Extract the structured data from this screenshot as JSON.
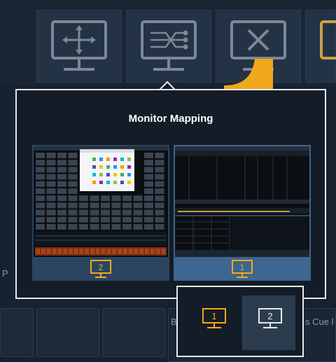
{
  "popup": {
    "title": "Monitor Mapping"
  },
  "monitors": [
    {
      "number": "2",
      "color": "#f0a81c"
    },
    {
      "number": "1",
      "color": "#f0a81c"
    }
  ],
  "selector": [
    {
      "number": "1",
      "color": "#f0a81c"
    },
    {
      "number": "2",
      "color": "#e6e9ee"
    }
  ],
  "background": {
    "left_fragment": "P",
    "label_b": "B",
    "cue_fragment": "s Cue l"
  },
  "colors": {
    "accent": "#f0a81c",
    "popup_border": "#e6e9ee",
    "icon_gray": "#7d8896"
  }
}
